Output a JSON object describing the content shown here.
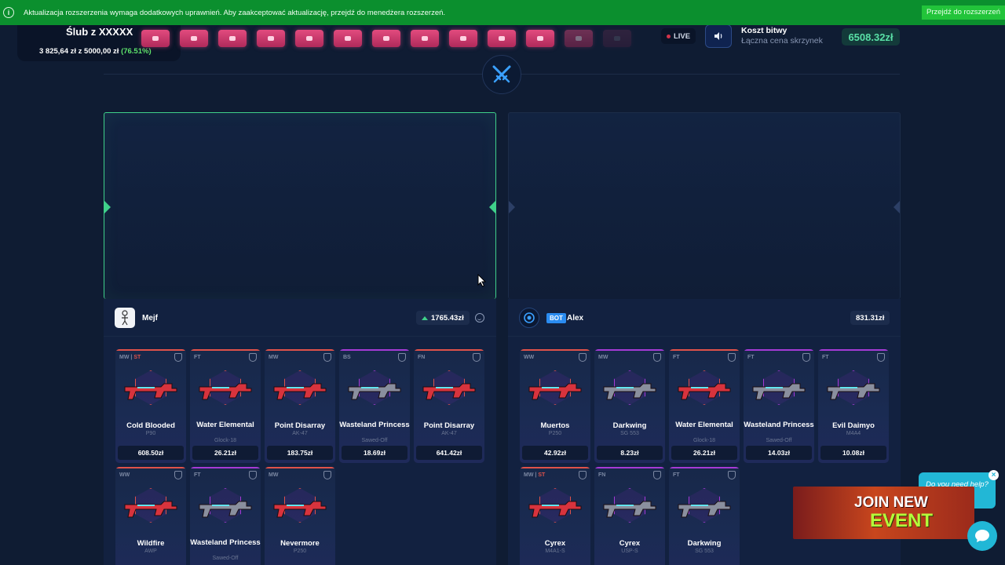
{
  "notification": {
    "text": "Aktualizacja rozszerzenia wymaga dodatkowych uprawnień. Aby zaakceptować aktualizację, przejdź do menedżera rozszerzeń.",
    "button": "Przejdź do rozszerzeń"
  },
  "badge": {
    "title": "Ślub z XXXXX",
    "progress_text": "3 825,64 zł",
    "of_word": "z",
    "goal_text": "5000,00 zł",
    "percent": "(76.51%)",
    "progress_fraction": 0.7651
  },
  "header": {
    "live_label": "LIVE",
    "battle_cost_label": "Koszt bitwy",
    "total_label": "Łączna cena skrzynek",
    "total_value": "6508.32zł"
  },
  "colors": {
    "accent_green": "#3fd08a",
    "background": "#0f1c33",
    "rarity_red": "#e0524a",
    "rarity_purple": "#a53ad6"
  },
  "players": [
    {
      "name": "Mejf",
      "is_bot": false,
      "value": "1765.43zł",
      "items": [
        {
          "wear": "MW",
          "stattrak": "ST",
          "name": "Cold Blooded",
          "sub": "P90",
          "price": "608.50zł",
          "rarity": "red"
        },
        {
          "wear": "FT",
          "stattrak": "",
          "name": "Water Elemental",
          "sub": "Glock-18",
          "price": "26.21zł",
          "rarity": "red"
        },
        {
          "wear": "MW",
          "stattrak": "",
          "name": "Point Disarray",
          "sub": "AK-47",
          "price": "183.75zł",
          "rarity": "red"
        },
        {
          "wear": "BS",
          "stattrak": "",
          "name": "Wasteland Princess",
          "sub": "Sawed-Off",
          "price": "18.69zł",
          "rarity": "purple"
        },
        {
          "wear": "FN",
          "stattrak": "",
          "name": "Point Disarray",
          "sub": "AK-47",
          "price": "641.42zł",
          "rarity": "red"
        },
        {
          "wear": "WW",
          "stattrak": "",
          "name": "Wildfire",
          "sub": "AWP",
          "price": "",
          "rarity": "red"
        },
        {
          "wear": "FT",
          "stattrak": "",
          "name": "Wasteland Princess",
          "sub": "Sawed-Off",
          "price": "",
          "rarity": "purple"
        },
        {
          "wear": "MW",
          "stattrak": "",
          "name": "Nevermore",
          "sub": "P250",
          "price": "",
          "rarity": "red"
        }
      ]
    },
    {
      "name": "Alex",
      "is_bot": true,
      "bot_label": "BOT",
      "value": "831.31zł",
      "items": [
        {
          "wear": "WW",
          "stattrak": "",
          "name": "Muertos",
          "sub": "P250",
          "price": "42.92zł",
          "rarity": "red"
        },
        {
          "wear": "MW",
          "stattrak": "",
          "name": "Darkwing",
          "sub": "SG 553",
          "price": "8.23zł",
          "rarity": "purple"
        },
        {
          "wear": "FT",
          "stattrak": "",
          "name": "Water Elemental",
          "sub": "Glock-18",
          "price": "26.21zł",
          "rarity": "red"
        },
        {
          "wear": "FT",
          "stattrak": "",
          "name": "Wasteland Princess",
          "sub": "Sawed-Off",
          "price": "14.03zł",
          "rarity": "purple"
        },
        {
          "wear": "FT",
          "stattrak": "",
          "name": "Evil Daimyo",
          "sub": "M4A4",
          "price": "10.08zł",
          "rarity": "purple"
        },
        {
          "wear": "MW",
          "stattrak": "ST",
          "name": "Cyrex",
          "sub": "M4A1-S",
          "price": "",
          "rarity": "red"
        },
        {
          "wear": "FN",
          "stattrak": "",
          "name": "Cyrex",
          "sub": "USP-S",
          "price": "",
          "rarity": "purple"
        },
        {
          "wear": "FT",
          "stattrak": "",
          "name": "Darkwing",
          "sub": "SG 553",
          "price": "",
          "rarity": "purple"
        }
      ]
    }
  ],
  "help": {
    "bubble_text": "Do you need help?"
  },
  "promo": {
    "line1": "JOIN NEW",
    "line2": "EVENT"
  }
}
